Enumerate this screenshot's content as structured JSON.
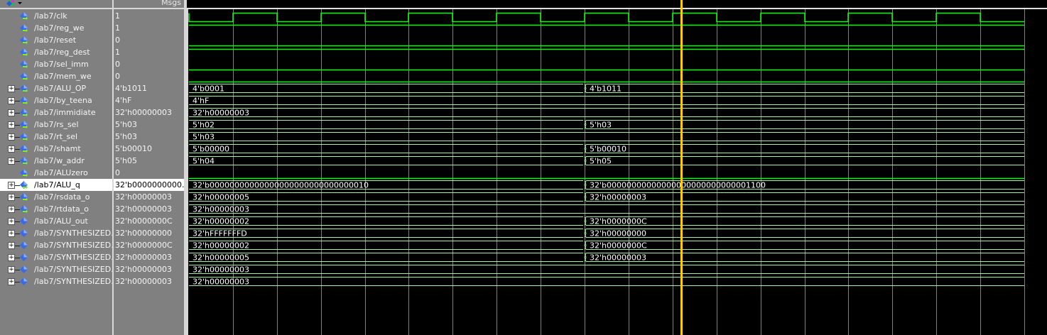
{
  "header": {
    "msgs_label": "Msgs",
    "toolbar_icon": "wave-signal-dropdown-icon"
  },
  "colors": {
    "panel": "#808080",
    "logic_wave": "#00ff00",
    "bus_wave": "#a8f0a8",
    "grid": "#808080",
    "cursor": "#ffcc00",
    "selected_row": "#ffffff"
  },
  "cursor": {
    "color": "#ffcc00"
  },
  "signals": [
    {
      "name": "/lab7/clk",
      "value": "1",
      "type": "clock",
      "expandable": false,
      "arrow": true
    },
    {
      "name": "/lab7/reg_we",
      "value": "1",
      "type": "bit",
      "level": 1,
      "expandable": false,
      "arrow": true
    },
    {
      "name": "/lab7/reset",
      "value": "0",
      "type": "bit",
      "level": 0,
      "expandable": false,
      "arrow": true
    },
    {
      "name": "/lab7/reg_dest",
      "value": "1",
      "type": "bit",
      "level": 1,
      "expandable": false,
      "arrow": true
    },
    {
      "name": "/lab7/sel_imm",
      "value": "0",
      "type": "bit",
      "level": 0,
      "expandable": false,
      "arrow": true
    },
    {
      "name": "/lab7/mem_we",
      "value": "0",
      "type": "bit",
      "level": 0,
      "expandable": false,
      "arrow": true
    },
    {
      "name": "/lab7/ALU_OP",
      "value": "4'b1011",
      "type": "bus",
      "segments": [
        "4'b0001",
        "4'b1011"
      ],
      "expandable": true,
      "arrow": true
    },
    {
      "name": "/lab7/by_teena",
      "value": "4'hF",
      "type": "bus",
      "segments": [
        "4'hF"
      ],
      "expandable": true,
      "arrow": true
    },
    {
      "name": "/lab7/immidiate",
      "value": "32'h00000003",
      "type": "bus",
      "segments": [
        "32'h00000003"
      ],
      "expandable": true,
      "arrow": true
    },
    {
      "name": "/lab7/rs_sel",
      "value": "5'h03",
      "type": "bus",
      "segments": [
        "5'h02",
        "5'h03"
      ],
      "expandable": true,
      "arrow": true
    },
    {
      "name": "/lab7/rt_sel",
      "value": "5'h03",
      "type": "bus",
      "segments": [
        "5'h03"
      ],
      "expandable": true,
      "arrow": true
    },
    {
      "name": "/lab7/shamt",
      "value": "5'b00010",
      "type": "bus",
      "segments": [
        "5'b00000",
        "5'b00010"
      ],
      "expandable": true,
      "arrow": true
    },
    {
      "name": "/lab7/w_addr",
      "value": "5'h05",
      "type": "bus",
      "segments": [
        "5'h04",
        "5'h05"
      ],
      "expandable": true,
      "arrow": true
    },
    {
      "name": "/lab7/ALUzero",
      "value": "0",
      "type": "bit",
      "level": 0,
      "expandable": false,
      "arrow": true
    },
    {
      "name": "/lab7/ALU_q",
      "value": "32'b0000000000...",
      "type": "bus",
      "segments": [
        "32'b00000000000000000000000000000010",
        "32'b00000000000000000000000000001100"
      ],
      "expandable": true,
      "arrow": true,
      "selected": true
    },
    {
      "name": "/lab7/rsdata_o",
      "value": "32'h00000003",
      "type": "bus",
      "segments": [
        "32'h00000005",
        "32'h00000003"
      ],
      "expandable": true,
      "arrow": true
    },
    {
      "name": "/lab7/rtdata_o",
      "value": "32'h00000003",
      "type": "bus",
      "segments": [
        "32'h00000003"
      ],
      "expandable": true,
      "arrow": true
    },
    {
      "name": "/lab7/ALU_out",
      "value": "32'h0000000C",
      "type": "bus",
      "segments": [
        "32'h00000002",
        "32'h0000000C"
      ],
      "expandable": true,
      "arrow": false
    },
    {
      "name": "/lab7/SYNTHESIZED...",
      "value": "32'h00000000",
      "type": "bus",
      "segments": [
        "32'hFFFFFFFD",
        "32'h00000000"
      ],
      "expandable": true,
      "arrow": false
    },
    {
      "name": "/lab7/SYNTHESIZED...",
      "value": "32'h0000000C",
      "type": "bus",
      "segments": [
        "32'h00000002",
        "32'h0000000C"
      ],
      "expandable": true,
      "arrow": false
    },
    {
      "name": "/lab7/SYNTHESIZED...",
      "value": "32'h00000003",
      "type": "bus",
      "segments": [
        "32'h00000005",
        "32'h00000003"
      ],
      "expandable": true,
      "arrow": false
    },
    {
      "name": "/lab7/SYNTHESIZED...",
      "value": "32'h00000003",
      "type": "bus",
      "segments": [
        "32'h00000003"
      ],
      "expandable": true,
      "arrow": false
    },
    {
      "name": "/lab7/SYNTHESIZED...",
      "value": "32'h00000003",
      "type": "bus",
      "segments": [
        "32'h00000003"
      ],
      "expandable": true,
      "arrow": false
    }
  ]
}
